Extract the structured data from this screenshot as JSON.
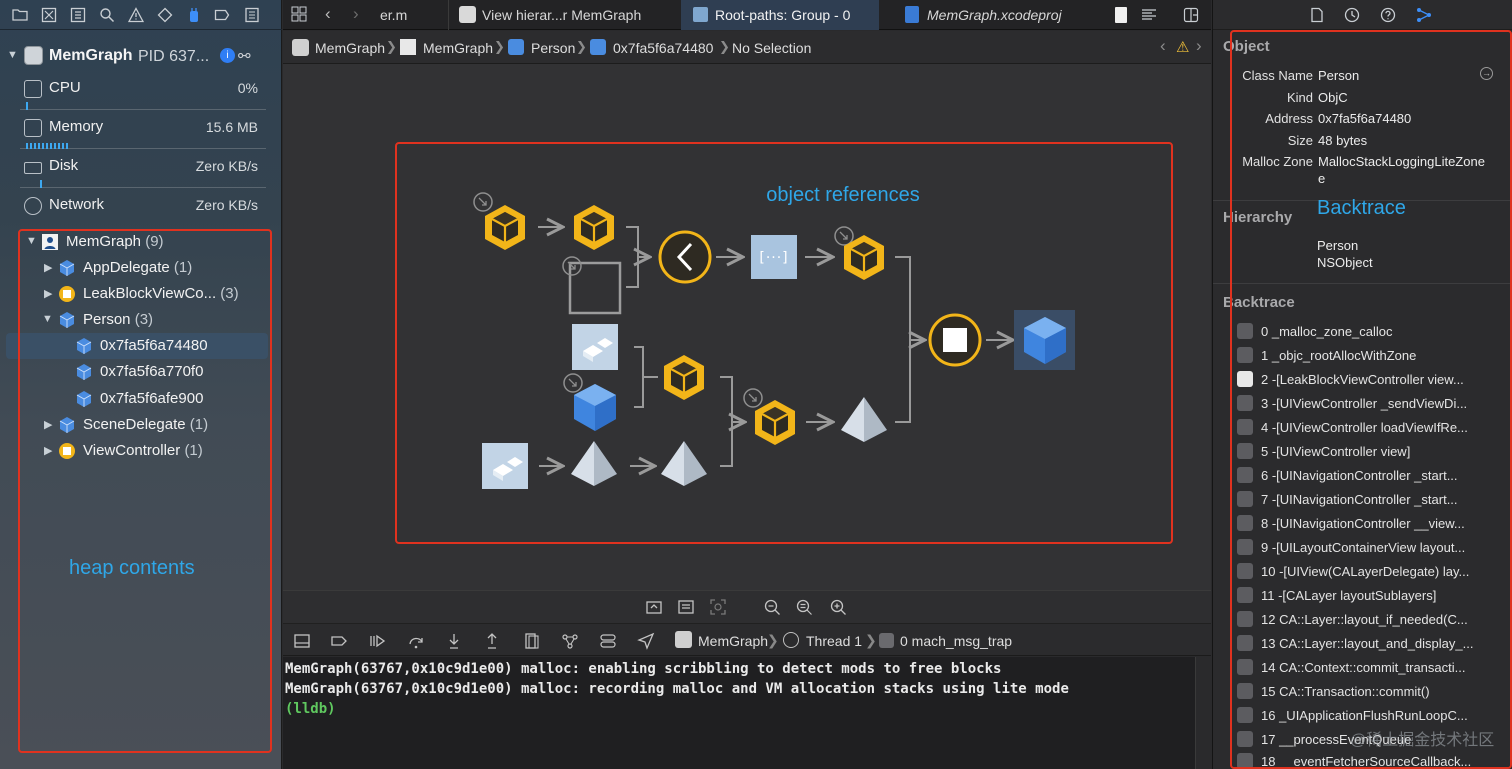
{
  "left": {
    "process": {
      "name": "MemGraph",
      "pid": "PID 637..."
    },
    "gauges": [
      {
        "label": "CPU",
        "value": "0%"
      },
      {
        "label": "Memory",
        "value": "15.6 MB"
      },
      {
        "label": "Disk",
        "value": "Zero KB/s"
      },
      {
        "label": "Network",
        "value": "Zero KB/s"
      }
    ],
    "tree": [
      {
        "label": "MemGraph",
        "count": "(9)"
      },
      {
        "label": "AppDelegate",
        "count": "(1)"
      },
      {
        "label": "LeakBlockViewCo...",
        "count": "(3)"
      },
      {
        "label": "Person",
        "count": "(3)"
      },
      {
        "label": "0x7fa5f6a74480",
        "count": ""
      },
      {
        "label": "0x7fa5f6a770f0",
        "count": ""
      },
      {
        "label": "0x7fa5f6afe900",
        "count": ""
      },
      {
        "label": "SceneDelegate",
        "count": "(1)"
      },
      {
        "label": "ViewController",
        "count": "(1)"
      }
    ],
    "annotation": "heap contents"
  },
  "tabs": [
    {
      "label": "er.m"
    },
    {
      "label": "View hierar...r MemGraph"
    },
    {
      "label": "Root-paths: Group - 0"
    },
    {
      "label": "MemGraph.xcodeproj"
    }
  ],
  "jumpbar": [
    "MemGraph",
    "MemGraph",
    "Person",
    "0x7fa5f6a74480",
    "No Selection"
  ],
  "graph": {
    "annotation": "object references"
  },
  "debugbar": {
    "process": "MemGraph",
    "thread": "Thread 1",
    "frame": "0 mach_msg_trap"
  },
  "console": [
    "MemGraph(63767,0x10c9d1e00) malloc: enabling scribbling to detect mods to free blocks",
    "MemGraph(63767,0x10c9d1e00) malloc: recording malloc and VM allocation stacks using lite mode",
    "(lldb)"
  ],
  "inspector": {
    "object_title": "Object",
    "fields": [
      {
        "key": "Class Name",
        "value": "Person"
      },
      {
        "key": "Kind",
        "value": "ObjC"
      },
      {
        "key": "Address",
        "value": "0x7fa5f6a74480"
      },
      {
        "key": "Size",
        "value": "48 bytes"
      },
      {
        "key": "Malloc Zone",
        "value": "MallocStackLoggingLiteZone"
      },
      {
        "key": "",
        "value": "e"
      }
    ],
    "hierarchy_title": "Hierarchy",
    "hierarchy": [
      "Person",
      "NSObject"
    ],
    "backtrace_title": "Backtrace",
    "annotation": "Backtrace",
    "backtrace": [
      "0 _malloc_zone_calloc",
      "1 _objc_rootAllocWithZone",
      "2 -[LeakBlockViewController view...",
      "3 -[UIViewController _sendViewDi...",
      "4 -[UIViewController loadViewIfRe...",
      "5 -[UIViewController view]",
      "6 -[UINavigationController _start...",
      "7 -[UINavigationController _start...",
      "8 -[UINavigationController __view...",
      "9 -[UILayoutContainerView layout...",
      "10 -[UIView(CALayerDelegate) lay...",
      "11 -[CALayer layoutSublayers]",
      "12 CA::Layer::layout_if_needed(C...",
      "13 CA::Layer::layout_and_display_...",
      "14 CA::Context::commit_transacti...",
      "15 CA::Transaction::commit()",
      "16 _UIApplicationFlushRunLoopC...",
      "17 __processEventQueue",
      "18 __eventFetcherSourceCallback..."
    ],
    "watermark": "@稀土掘金技术社区"
  },
  "colors": {
    "accent": "#2fa7e8",
    "highlight": "#e0321f",
    "object": "#f2b519"
  }
}
